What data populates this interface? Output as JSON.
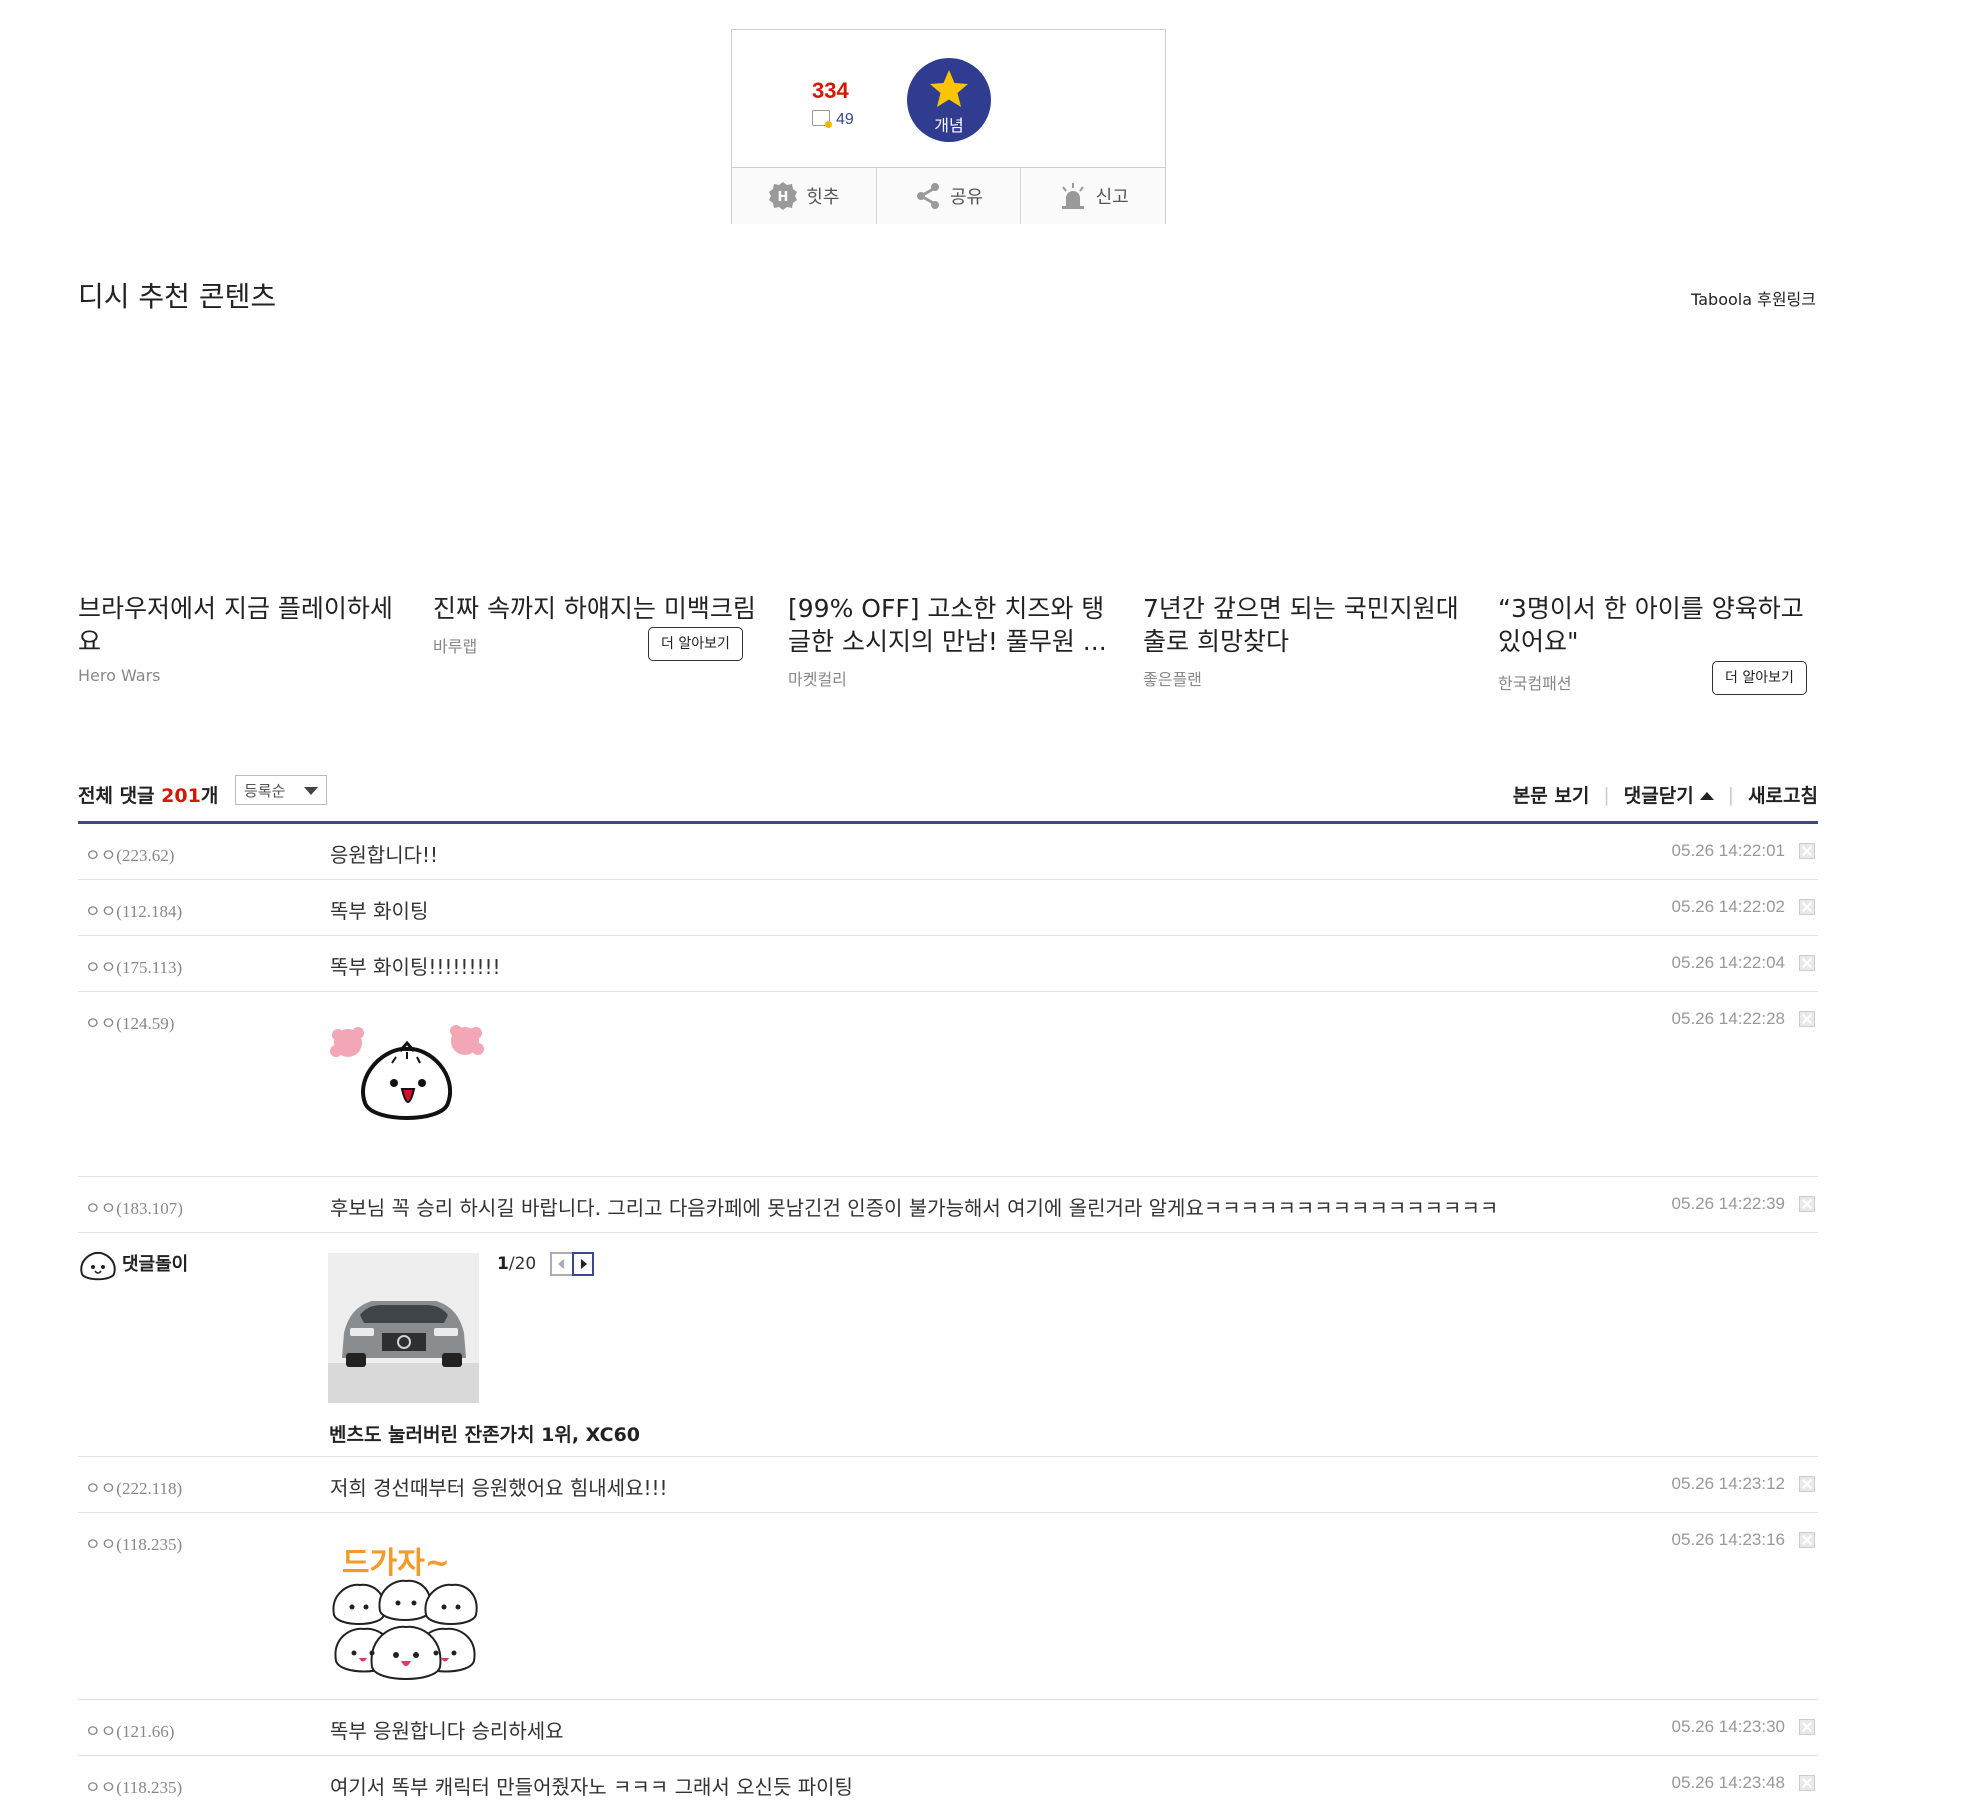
{
  "recommend": {
    "count": "334",
    "fixed_count": "49",
    "concept_label": "개념",
    "actions": [
      {
        "label": "힛추",
        "icon": "hit-icon"
      },
      {
        "label": "공유",
        "icon": "share-icon"
      },
      {
        "label": "신고",
        "icon": "report-siren-icon"
      }
    ]
  },
  "content_section": {
    "title": "디시 추천 콘텐츠",
    "taboola_link": "Taboola 후원링크",
    "cards": [
      {
        "title": "브라우저에서 지금 플레이하세요",
        "source": "Hero Wars",
        "button": ""
      },
      {
        "title": "진짜 속까지 하얘지는 미백크림",
        "source": "바루랩",
        "button": "더 알아보기"
      },
      {
        "title": "[99% OFF] 고소한 치즈와 탱글한 소시지의 만남! 풀무원 ...",
        "source": "마켓컬리",
        "button": ""
      },
      {
        "title": "7년간 갚으면 되는 국민지원대출로 희망찾다",
        "source": "좋은플랜",
        "button": ""
      },
      {
        "title": "“3명이서 한 아이를 양육하고 있어요\"",
        "source": "한국컴패션",
        "button": "더 알아보기"
      }
    ]
  },
  "comments_header": {
    "total_prefix": "전체 댓글 ",
    "total_count": "201",
    "total_suffix": "개",
    "sort_value": "등록순",
    "view_post": "본문 보기",
    "close_comments": "댓글닫기",
    "refresh": "새로고침"
  },
  "comments": [
    {
      "nick": "ㅇㅇ(223.62)",
      "text": "응원합니다!!",
      "date": "05.26 14:22:01"
    },
    {
      "nick": "ㅇㅇ(112.184)",
      "text": "똑부 화이팅",
      "date": "05.26 14:22:02"
    },
    {
      "nick": "ㅇㅇ(175.113)",
      "text": "똑부 화이팅!!!!!!!!!",
      "date": "05.26 14:22:04"
    },
    {
      "nick": "ㅇㅇ(124.59)",
      "text": "",
      "date": "05.26 14:22:28",
      "sticker": "dumpling-cheer-sticker"
    },
    {
      "nick": "ㅇㅇ(183.107)",
      "text": "후보님 꼭 승리 하시길 바랍니다. 그리고 다음카페에 못남긴건 인증이 불가능해서 여기에 올린거라 알게요ㅋㅋㅋㅋㅋㅋㅋㅋㅋㅋㅋㅋㅋㅋㅋㅋ",
      "date": "05.26 14:22:39"
    },
    {
      "nick": "ㅇㅇ(222.118)",
      "text": "저희 경선때부터 응원했어요 힘내세요!!!",
      "date": "05.26 14:23:12"
    },
    {
      "nick": "ㅇㅇ(118.235)",
      "text": "",
      "date": "05.26 14:23:16",
      "sticker": "dumpling-group-sticker"
    },
    {
      "nick": "ㅇㅇ(121.66)",
      "text": "똑부 응원합니다 승리하세요",
      "date": "05.26 14:23:30"
    },
    {
      "nick": "ㅇㅇ(118.235)",
      "text": "여기서 똑부 캐릭터 만들어줬자노 ㅋㅋㅋ 그래서 오신듯 파이팅",
      "date": "05.26 14:23:48"
    }
  ],
  "comment_bot": {
    "name": "댓글돌이",
    "page_current": "1",
    "page_total": "/20",
    "ad_title": "벤츠도 눌러버린 잔존가치 1위, XC60"
  },
  "sticker_text": "드가자~"
}
